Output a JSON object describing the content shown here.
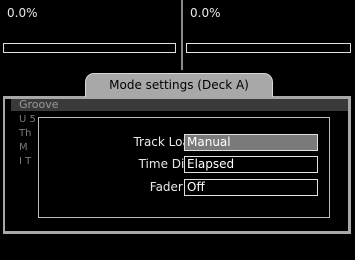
{
  "decks": {
    "a": {
      "percent_text": "0.0%",
      "progress": 0.0
    },
    "b": {
      "percent_text": "0.0%",
      "progress": 0.0
    }
  },
  "background_list": {
    "header": "Groove",
    "items": [
      "U 5",
      "Th",
      "M",
      "I T"
    ]
  },
  "dialog": {
    "title": "Mode settings (Deck A)",
    "rows": [
      {
        "label": "Track Loading",
        "value": "Manual",
        "selected": true
      },
      {
        "label": "Time Display",
        "value": "Elapsed",
        "selected": false
      },
      {
        "label": "Fader Start",
        "value": "Off",
        "selected": false
      }
    ]
  },
  "colors": {
    "background": "#000000",
    "frame": "#a8a8a8",
    "selected_value_bg": "#7a7a7a",
    "text": "#e8e8e8"
  }
}
